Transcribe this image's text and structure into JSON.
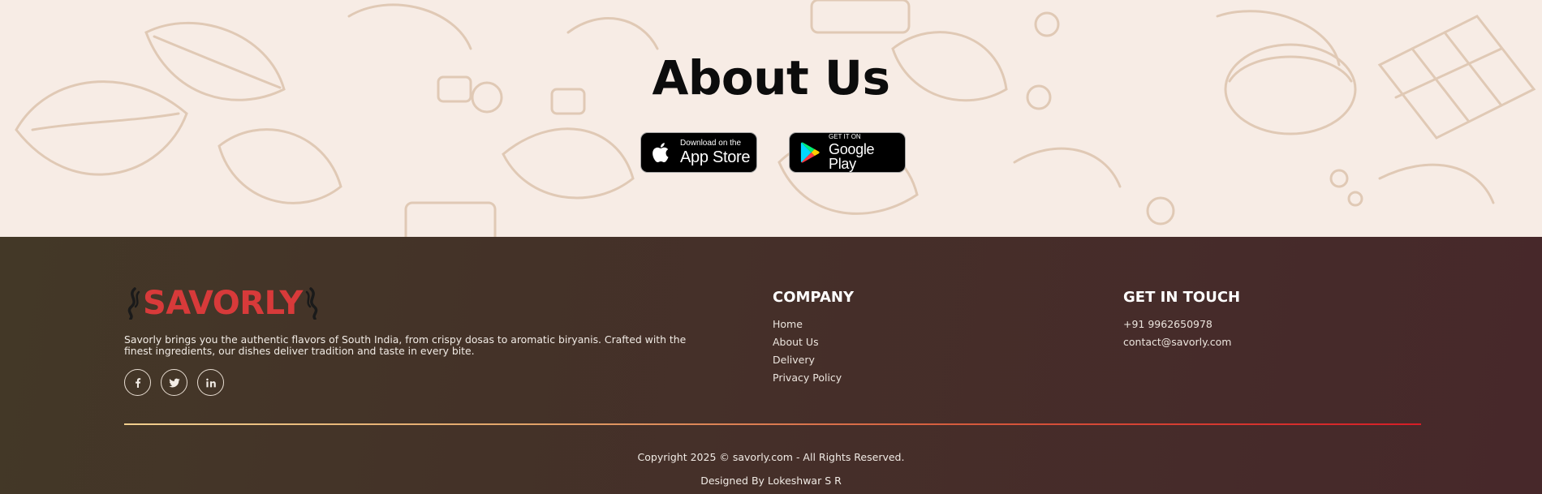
{
  "about": {
    "title": "About Us",
    "app_store": {
      "small": "Download on the",
      "big": "App Store",
      "icon": "apple-icon"
    },
    "google_play": {
      "small": "GET IT ON",
      "big": "Google Play",
      "icon": "google-play-icon"
    }
  },
  "footer": {
    "brand": "SAVORLY",
    "description": "Savorly brings you the authentic flavors of South India, from crispy dosas to aromatic biryanis. Crafted with the finest ingredients, our dishes deliver tradition and taste in every bite.",
    "socials": [
      {
        "icon": "facebook-icon"
      },
      {
        "icon": "twitter-icon"
      },
      {
        "icon": "linkedin-icon"
      }
    ],
    "company": {
      "title": "COMPANY",
      "links": [
        "Home",
        "About Us",
        "Delivery",
        "Privacy Policy"
      ]
    },
    "contact": {
      "title": "GET IN TOUCH",
      "phone": "+91 9962650978",
      "email": "contact@savorly.com"
    },
    "copyright": "Copyright 2025 © savorly.com - All Rights Reserved.",
    "designer": "Designed By Lokeshwar S R"
  },
  "colors": {
    "brand_red": "#d83a3a",
    "footer_bg_start": "#433827",
    "footer_bg_end": "#47282a",
    "about_bg": "#f7ece5",
    "divider_start": "#f1cf8e",
    "divider_end": "#d71d26"
  }
}
